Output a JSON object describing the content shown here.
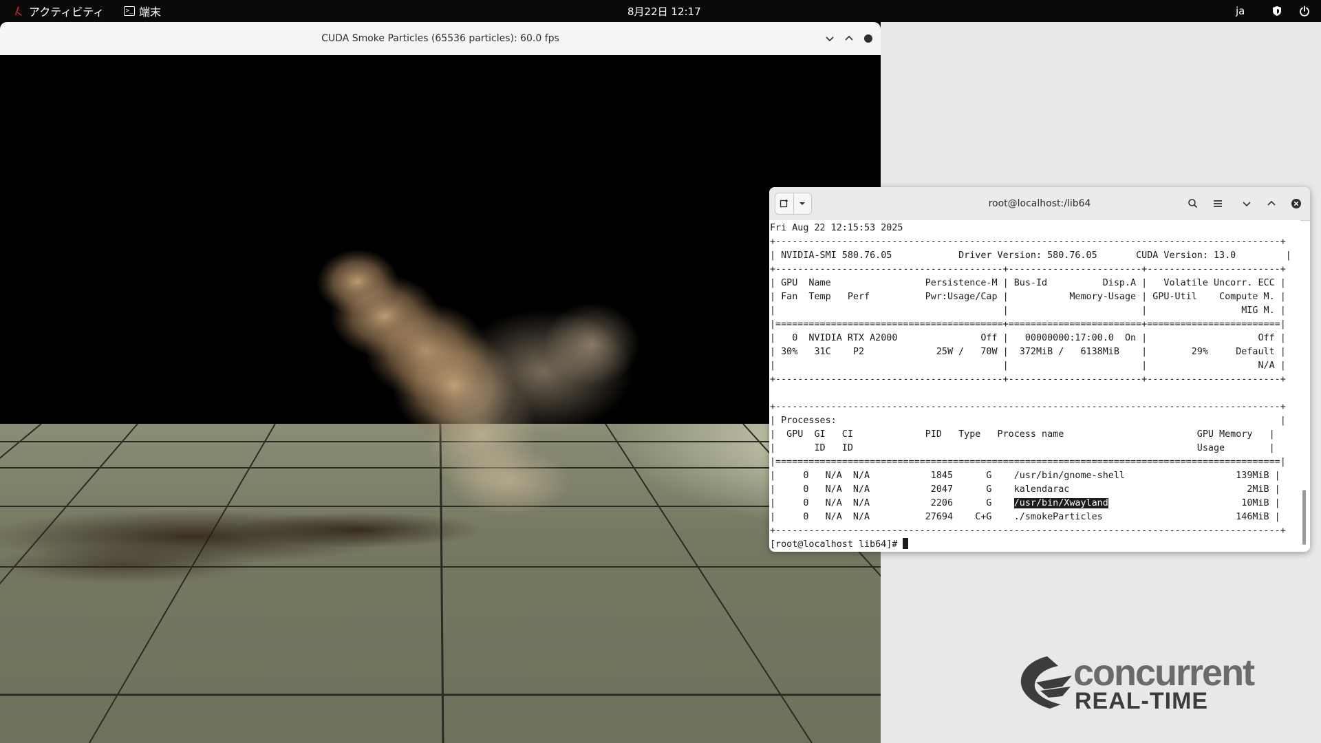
{
  "topbar": {
    "activities_label": "アクティビティ",
    "app_label": "端末",
    "clock": "8月22日  12:17",
    "lang": "ja",
    "icons": [
      "shield-icon",
      "power-icon"
    ]
  },
  "smoke_window": {
    "title": "CUDA Smoke Particles (65536 particles): 60.0 fps",
    "buttons": [
      "minimize-icon",
      "maximize-icon",
      "close-icon"
    ]
  },
  "terminal": {
    "title": "root@localhost:/lib64",
    "timestamp": "Fri Aug 22 12:15:53 2025",
    "smi": {
      "nvidia_smi": "580.76.05",
      "driver_version": "580.76.05",
      "cuda_version": "13.0",
      "headers": [
        "GPU",
        "Name",
        "Persistence-M",
        "Bus-Id",
        "Disp.A",
        "Volatile Uncorr. ECC",
        "Fan",
        "Temp",
        "Perf",
        "Pwr:Usage/Cap",
        "Memory-Usage",
        "GPU-Util",
        "Compute M.",
        "MIG M."
      ],
      "gpu": {
        "index": "0",
        "name": "NVIDIA RTX A2000",
        "persistence": "Off",
        "bus_id": "00000000:17:00.0",
        "disp": "On",
        "ecc": "Off",
        "fan": "30%",
        "temp": "31C",
        "perf": "P2",
        "power": "25W /   70W",
        "memory": "372MiB /   6138MiB",
        "util": "29%",
        "compute": "Default",
        "mig": "N/A"
      }
    },
    "processes": {
      "title": "Processes:",
      "headers": [
        "GPU",
        "GI ID",
        "CI ID",
        "PID",
        "Type",
        "Process name",
        "GPU Memory Usage"
      ],
      "rows": [
        {
          "gpu": "0",
          "gi": "N/A",
          "ci": "N/A",
          "pid": "1845",
          "type": "G",
          "name": "/usr/bin/gnome-shell",
          "mem": "139MiB"
        },
        {
          "gpu": "0",
          "gi": "N/A",
          "ci": "N/A",
          "pid": "2047",
          "type": "G",
          "name": "kalendarac",
          "mem": "2MiB"
        },
        {
          "gpu": "0",
          "gi": "N/A",
          "ci": "N/A",
          "pid": "2206",
          "type": "G",
          "name": "/usr/bin/Xwayland",
          "mem": "10MiB",
          "selected": true
        },
        {
          "gpu": "0",
          "gi": "N/A",
          "ci": "N/A",
          "pid": "27694",
          "type": "C+G",
          "name": "./smokeParticles",
          "mem": "146MiB"
        }
      ]
    },
    "prompt": "[root@localhost lib64]# "
  },
  "desktop_logo": {
    "line1": "concurrent",
    "line2": "REAL-TIME"
  }
}
